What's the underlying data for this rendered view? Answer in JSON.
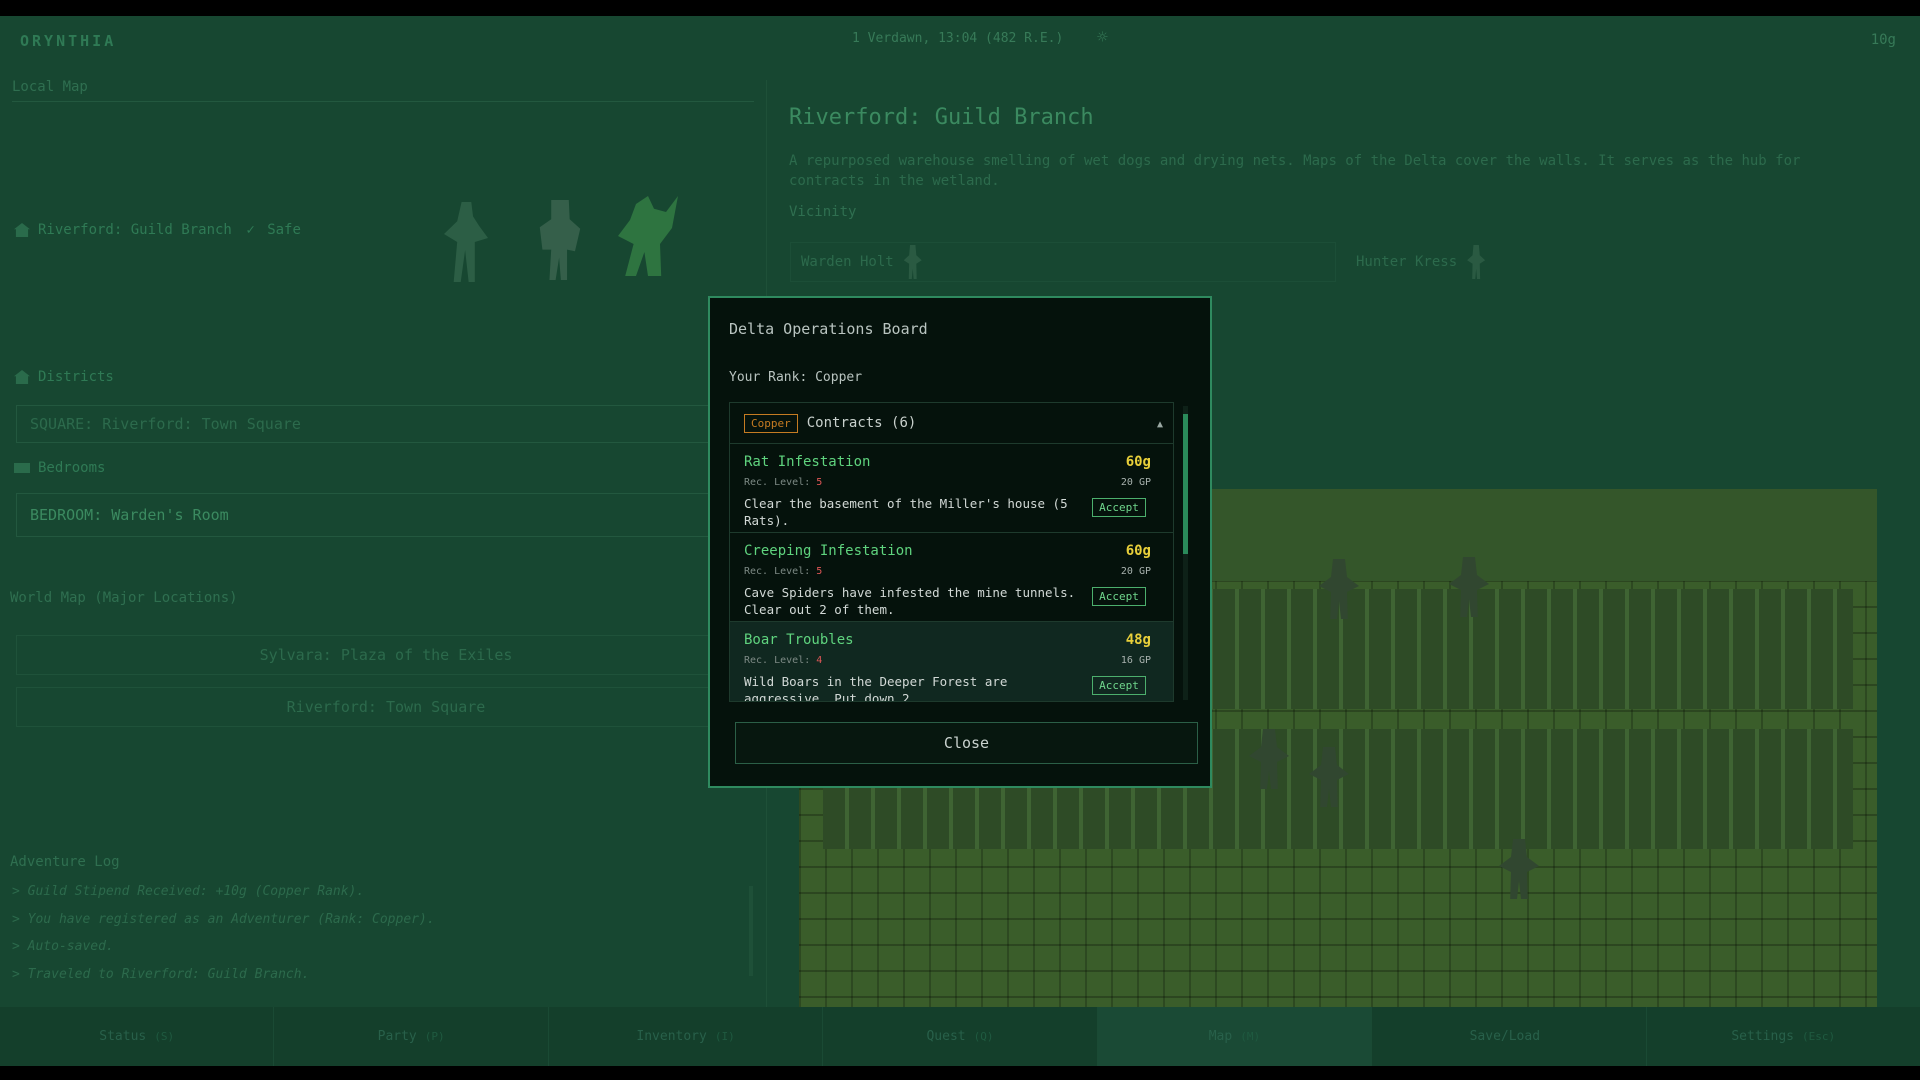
{
  "topbar": {
    "brand": "ORYNTHIA",
    "datetime": "1 Verdawn, 13:04 (482 R.E.)",
    "gold": "10g",
    "weather_icon": "sun-icon"
  },
  "left_panel": {
    "local_map_title": "Local Map",
    "current_location": "Riverford: Guild Branch",
    "safe_label": "Safe",
    "districts_label": "Districts",
    "district_square": "SQUARE: Riverford: Town Square",
    "bedrooms_label": "Bedrooms",
    "bedroom": "BEDROOM: Warden's Room",
    "world_map_title": "World Map (Major Locations)",
    "world_locations": [
      "Sylvara: Plaza of the Exiles",
      "Riverford: Town Square"
    ],
    "log_title": "Adventure Log",
    "log_entries": [
      "> Guild Stipend Received: +10g (Copper Rank).",
      "> You have registered as an Adventurer (Rank: Copper).",
      "> Auto-saved.",
      "> Traveled to Riverford: Guild Branch."
    ]
  },
  "right_panel": {
    "title": "Riverford: Guild Branch",
    "description": "A repurposed warehouse smelling of wet dogs and drying nets. Maps of the Delta cover the walls. It serves as the hub for contracts in the wetland.",
    "vicinity_label": "Vicinity",
    "npcs": [
      "Warden Holt",
      "Hunter Kress"
    ]
  },
  "tabs": [
    {
      "label": "Status",
      "key": "(S)"
    },
    {
      "label": "Party",
      "key": "(P)"
    },
    {
      "label": "Inventory",
      "key": "(I)"
    },
    {
      "label": "Quest",
      "key": "(Q)"
    },
    {
      "label": "Map",
      "key": "(M)"
    },
    {
      "label": "Save/Load",
      "key": ""
    },
    {
      "label": "Settings",
      "key": "(Esc)"
    }
  ],
  "modal": {
    "title": "Delta Operations Board",
    "rank_text": "Your Rank: Copper",
    "rank_badge": "Copper",
    "contracts_label": "Contracts (6)",
    "level_prefix": "Rec. Level: ",
    "accept_label": "Accept",
    "close_label": "Close",
    "contracts": [
      {
        "name": "Rat Infestation",
        "level": "5",
        "gold": "60g",
        "gp": "20 GP",
        "desc": "Clear the basement of the Miller's house (5 Rats)."
      },
      {
        "name": "Creeping Infestation",
        "level": "5",
        "gold": "60g",
        "gp": "20 GP",
        "desc": "Cave Spiders have infested the mine tunnels. Clear out 2 of them."
      },
      {
        "name": "Boar Troubles",
        "level": "4",
        "gold": "48g",
        "gp": "16 GP",
        "desc": "Wild Boars in the Deeper Forest are aggressive. Put down 2"
      }
    ]
  },
  "colors": {
    "accent": "#2f8a5f",
    "gold": "#e8cf3a",
    "contract_name": "#5fd37e",
    "badge": "#c57b22"
  }
}
